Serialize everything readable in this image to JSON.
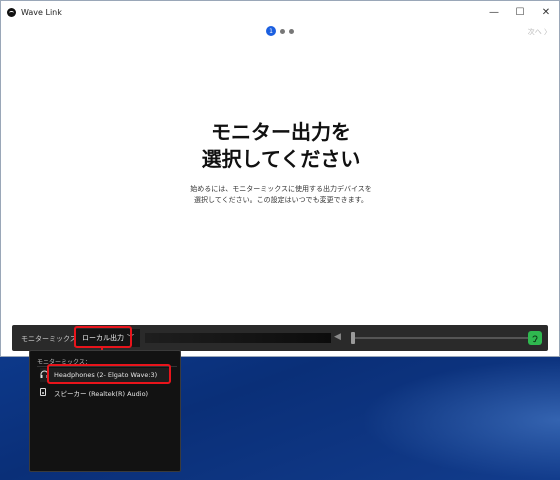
{
  "window": {
    "title": "Wave Link",
    "controls": {
      "minimize": "—",
      "maximize": "☐",
      "close": "✕"
    }
  },
  "pager": {
    "current": "1",
    "next_label": "次へ 〉"
  },
  "headline": {
    "line1": "モニター出力を",
    "line2": "選択してください"
  },
  "subtext": {
    "line1": "始めるには、モニターミックスに使用する出力デバイスを",
    "line2": "選択してください。この設定はいつでも変更できます。"
  },
  "mixbar": {
    "label": "モニターミックス",
    "selected_output": "ローカル出力",
    "mute_icon": "speaker-icon",
    "ear_icon": "ear-icon",
    "accent_color": "#2fb84f"
  },
  "dropdown": {
    "title": "モニターミックス：",
    "devices": [
      {
        "label": "Headphones (2- Elgato Wave:3)",
        "icon": "headphones-icon"
      },
      {
        "label": "スピーカー (Realtek(R) Audio)",
        "icon": "speaker-device-icon"
      }
    ]
  },
  "colors": {
    "callout": "#e8141b",
    "page_dot_active": "#1b5fe0"
  }
}
